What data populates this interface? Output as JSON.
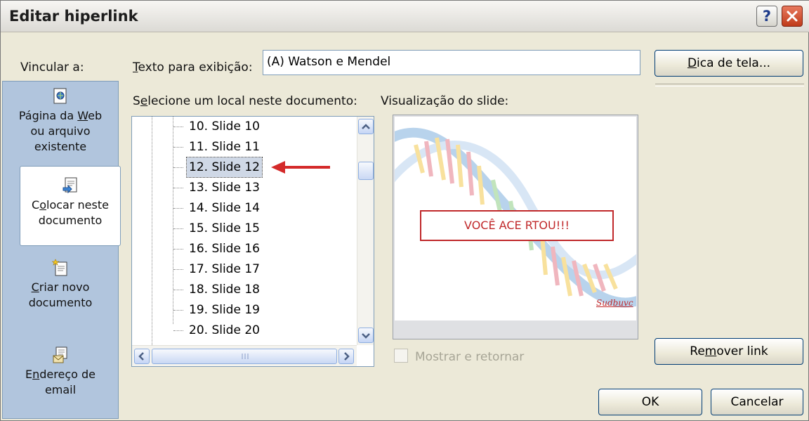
{
  "title": "Editar hiperlink",
  "title_buttons": {
    "help": "?",
    "close_icon": "close-icon"
  },
  "link_to": {
    "label": "Vincular a:",
    "places": [
      {
        "icon": "web-page-icon",
        "line1_pre": "Página da ",
        "line1_accel": "W",
        "line1_post": "eb",
        "line2": "ou arquivo",
        "line3": "existente"
      },
      {
        "icon": "place-in-document-icon",
        "line1_pre": "C",
        "line1_accel": "o",
        "line1_post": "locar neste",
        "line2": "documento",
        "selected": true
      },
      {
        "icon": "new-document-icon",
        "line1_pre": "",
        "line1_accel": "C",
        "line1_post": "riar novo",
        "line2": "documento"
      },
      {
        "icon": "email-address-icon",
        "line1_pre": "E",
        "line1_accel": "n",
        "line1_post": "dereço de",
        "line2": "email"
      }
    ]
  },
  "display_text": {
    "label_accel": "T",
    "label_rest": "exto para exibição:",
    "value": "(A) Watson e Mendel"
  },
  "screentip_button": {
    "accel": "D",
    "rest": "ica de tela..."
  },
  "select_place": {
    "label_pre": "S",
    "label_accel": "e",
    "label_rest": "lecione um local neste documento:"
  },
  "tree_items": [
    "10. Slide 10",
    "11. Slide 11",
    "12. Slide 12",
    "13. Slide 13",
    "14. Slide 14",
    "15. Slide 15",
    "16. Slide 16",
    "17. Slide 17",
    "18. Slide 18",
    "19. Slide 19",
    "20. Slide 20"
  ],
  "selected_item": "12. Slide 12",
  "preview": {
    "label": "Visualização do slide:",
    "slide_text": "VOCÊ ACE RTOU!!!",
    "signature": "Sudbuvc"
  },
  "show_and_return": {
    "label": "Mostrar e retornar",
    "checked": false,
    "enabled": false
  },
  "remove_link_button": {
    "pre": "Re",
    "accel": "m",
    "post": "over link"
  },
  "ok_button": "OK",
  "cancel_button": "Cancelar",
  "colors": {
    "accent": "#003c74",
    "arrow": "#d42a2a",
    "slide_text": "#c0282a",
    "panel": "#b1c5dd"
  }
}
